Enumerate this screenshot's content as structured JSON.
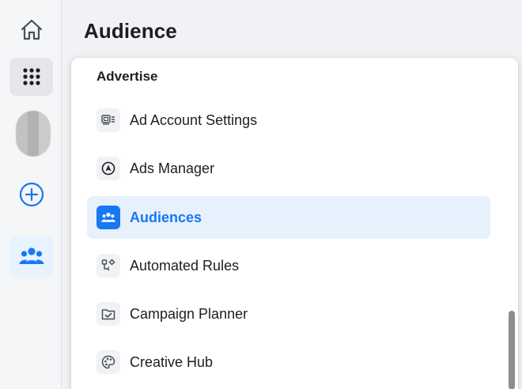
{
  "header": {
    "title": "Audience"
  },
  "rail": {
    "items": [
      {
        "icon": "home-icon"
      },
      {
        "icon": "grid-menu-icon"
      },
      {
        "icon": "avatar"
      },
      {
        "icon": "plus-circle-icon"
      },
      {
        "icon": "audiences-icon",
        "active": true
      }
    ]
  },
  "menu": {
    "heading": "Advertise",
    "items": [
      {
        "label": "Ad Account Settings",
        "icon": "ad-account-settings-icon"
      },
      {
        "label": "Ads Manager",
        "icon": "ads-manager-icon"
      },
      {
        "label": "Audiences",
        "icon": "audiences-icon",
        "selected": true
      },
      {
        "label": "Automated Rules",
        "icon": "automated-rules-icon"
      },
      {
        "label": "Campaign Planner",
        "icon": "campaign-planner-icon"
      },
      {
        "label": "Creative Hub",
        "icon": "creative-hub-icon"
      }
    ]
  },
  "colors": {
    "accent": "#1877f2",
    "selected_bg": "#e7f0fd",
    "text": "#1c1e21",
    "rail_bg": "#f5f6f7"
  }
}
